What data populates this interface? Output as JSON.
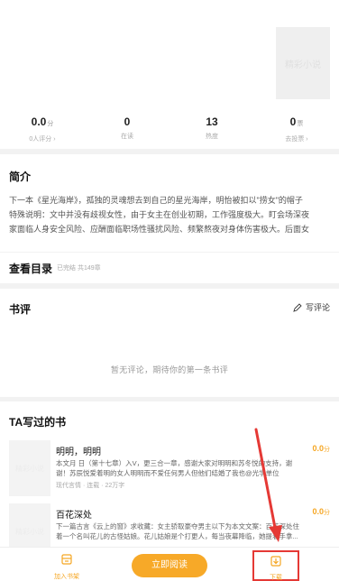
{
  "cover": {
    "text": "精彩小说"
  },
  "stats": [
    {
      "value": "0.0",
      "unit": "分",
      "label": "0人评分 ›"
    },
    {
      "value": "0",
      "unit": "",
      "label": "在读"
    },
    {
      "value": "13",
      "unit": "",
      "label": "热度"
    },
    {
      "value": "0",
      "unit": "票",
      "label": "去投票 ›"
    }
  ],
  "intro": {
    "title": "简介",
    "lines": [
      "下一本《星光海岸》，孤独的灵魂想去到自己的星光海岸，明怡被扣以\"捞女\"的帽子",
      "特殊说明：文中并没有歧视女性，由于女主在创业初期，工作强度极大。盯会场深夜",
      "家面临人身安全风险、应酬面临职场性骚扰风险、频繁熬夜对身体伤害极大。后面女"
    ]
  },
  "toc": {
    "title": "查看目录",
    "sub": "已完结 共149章"
  },
  "review": {
    "title": "书评",
    "write": "写评论",
    "empty": "暂无评论，期待你的第一条书评"
  },
  "author_books": {
    "title": "TA写过的书",
    "books": [
      {
        "thumb": "精彩小说",
        "name": "明明，明明",
        "score": "0.0",
        "unit": "分",
        "desc": [
          "本文月 日（第十七章）入V，更三合一章，感谢大家对明明和苏冬悦的支持，谢",
          "谢！苏辰悦爱着明的女人明明而不爱任何男人但他们结婚了我也@光学单位"
        ],
        "meta": "现代言情 · 连载 · 22万字"
      },
      {
        "thumb": "精彩小说",
        "name": "百花深处",
        "score": "0.0",
        "unit": "分",
        "desc": [
          "下一篇古言《云上的窗》求收藏：女主骄取豪夺男主以下为本文文案：百花深处住",
          "着一个名叫花儿的古怪姑娘。花儿姑娘是个打更人，每当夜幕降临，她提着手拿..."
        ],
        "meta": ""
      }
    ]
  },
  "bottom": {
    "shelf": "加入书架",
    "read": "立即阅读",
    "download": "下载"
  },
  "colors": {
    "accent": "#f7a928",
    "highlight": "#e53935"
  }
}
